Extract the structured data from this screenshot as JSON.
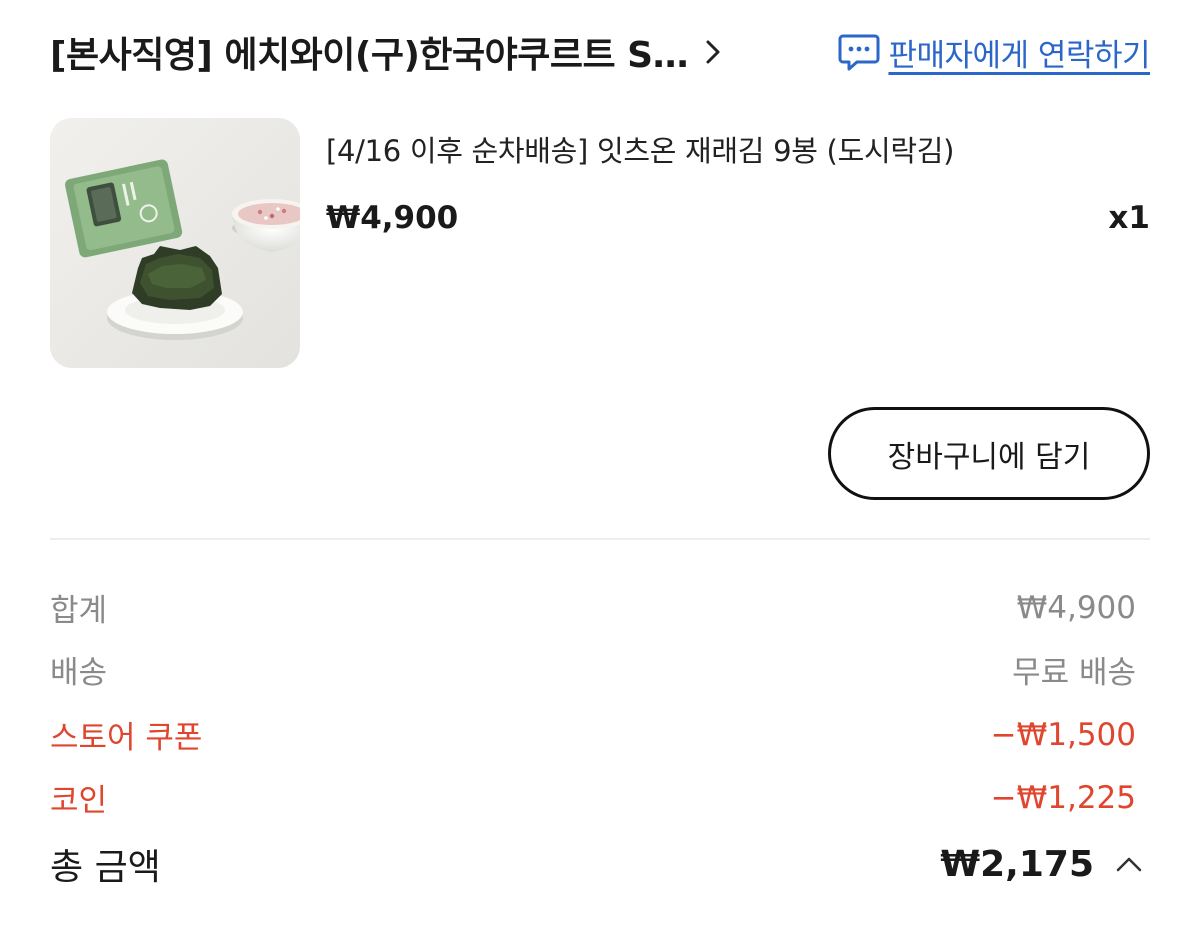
{
  "header": {
    "store_name": "[본사직영] 에치와이(구)한국야쿠르트 S…",
    "contact_label": "판매자에게 연락하기"
  },
  "product": {
    "title": "[4/16 이후 순차배송] 잇츠온 재래김 9봉 (도시락김)",
    "price": "₩4,900",
    "quantity": "x1",
    "image_label": "seaweed-product-photo"
  },
  "cart_button": {
    "label": "장바구니에 담기"
  },
  "summary": {
    "subtotal": {
      "label": "합계",
      "value": "₩4,900"
    },
    "shipping": {
      "label": "배송",
      "value": "무료 배송"
    },
    "store_coupon": {
      "label": "스토어 쿠폰",
      "value": "−₩1,500"
    },
    "coin": {
      "label": "코인",
      "value": "−₩1,225"
    },
    "total": {
      "label": "총 금액",
      "value": "₩2,175"
    }
  },
  "colors": {
    "accent_blue": "#2b67c9",
    "discount_red": "#e0452e",
    "muted_gray": "#8a8a8a"
  },
  "icons": {
    "store_chevron": "chevron-right-icon",
    "contact": "chat-bubble-icon",
    "total_toggle": "chevron-up-icon"
  }
}
